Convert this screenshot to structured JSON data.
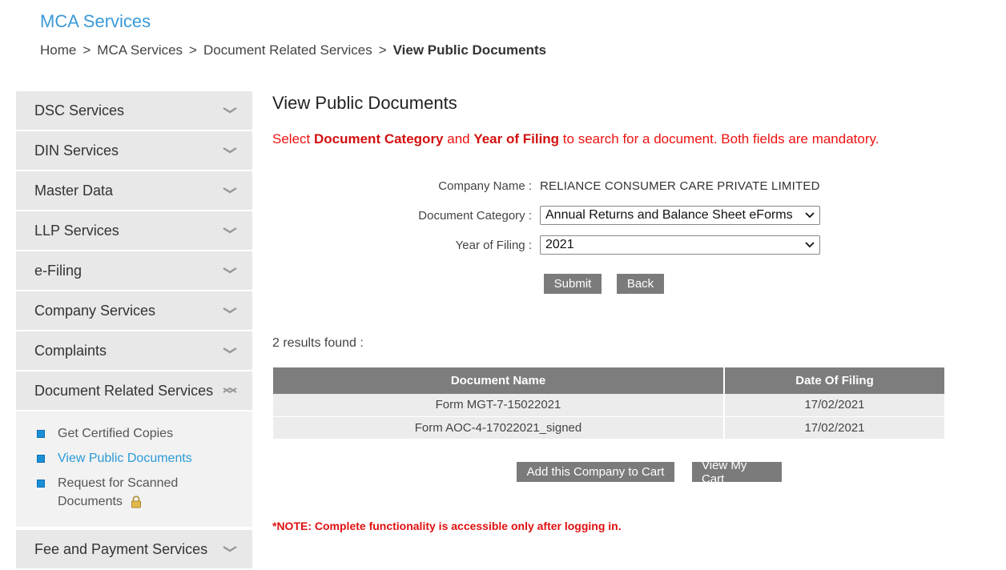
{
  "header": {
    "title": "MCA Services",
    "breadcrumb": [
      "Home",
      "MCA Services",
      "Document Related Services",
      "View Public Documents"
    ],
    "separator": ">"
  },
  "sidebar": {
    "items": [
      {
        "label": "DSC Services"
      },
      {
        "label": "DIN Services"
      },
      {
        "label": "Master Data"
      },
      {
        "label": "LLP Services"
      },
      {
        "label": "e-Filing"
      },
      {
        "label": "Company Services"
      },
      {
        "label": "Complaints"
      },
      {
        "label": "Document Related Services"
      }
    ],
    "submenu": [
      {
        "label": "Get Certified Copies"
      },
      {
        "label": "View Public Documents"
      },
      {
        "label": "Request for Scanned Documents"
      }
    ],
    "last_item": {
      "label": "Fee and Payment Services"
    }
  },
  "main": {
    "title": "View Public Documents",
    "instruction": {
      "part1": "Select ",
      "bold1": "Document Category",
      "part2": " and ",
      "bold2": "Year of Filing",
      "part3": " to search for a document. Both fields are mandatory."
    },
    "form": {
      "company_label": "Company Name :",
      "company_value": "RELIANCE CONSUMER CARE PRIVATE LIMITED",
      "category_label": "Document Category :",
      "category_value": "Annual Returns and Balance Sheet eForms",
      "year_label": "Year of Filing :",
      "year_value": "2021"
    },
    "buttons": {
      "submit": "Submit",
      "back": "Back",
      "add_cart": "Add this Company to Cart",
      "view_cart": "View My Cart"
    },
    "results_text": "2  results found :",
    "table": {
      "headers": [
        "Document Name",
        "Date Of Filing"
      ],
      "rows": [
        [
          "Form MGT-7-15022021",
          "17/02/2021"
        ],
        [
          "Form AOC-4-17022021_signed",
          "17/02/2021"
        ]
      ]
    },
    "note": "*NOTE: Complete functionality is accessible only after logging in."
  },
  "colors": {
    "accent": "#3a9ad9",
    "warning": "#ee1111",
    "button": "#7b7b7b"
  }
}
